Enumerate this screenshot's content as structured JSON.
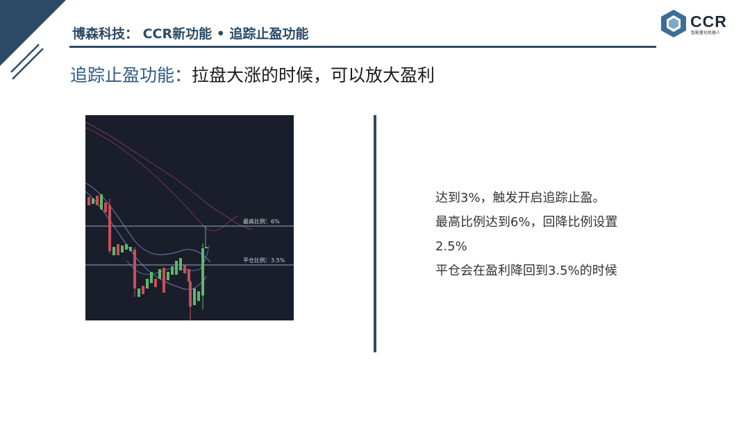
{
  "header": {
    "title": "博森科技： CCR新功能 • 追踪止盈功能"
  },
  "logo": {
    "word": "CCR",
    "sub": "智能量化机器人"
  },
  "subtitle": {
    "key": "追踪止盈功能：",
    "text": "拉盘大涨的时候，可以放大盈利"
  },
  "chart": {
    "high_label": "最高比例：6%",
    "close_label": "平仓比例：3.5%",
    "colors": {
      "background": "#1a1e2b",
      "up": "#5fb86a",
      "down": "#c94f5a",
      "level_line": "#9aa6c4"
    }
  },
  "notes": {
    "lines": [
      "达到3%，触发开启追踪止盈。",
      "最高比例达到6%，回降比例设置",
      "2.5%",
      "平仓会在盈利降回到3.5%的时候"
    ]
  }
}
